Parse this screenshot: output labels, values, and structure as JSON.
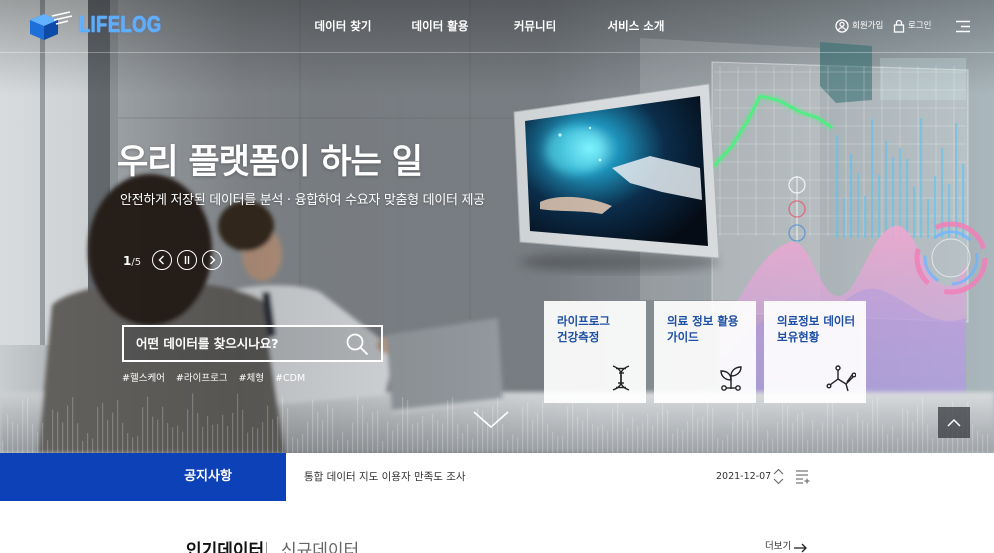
{
  "header": {
    "logo": {
      "text": "LIFELOG",
      "icon": "cube-logo-icon"
    },
    "nav": [
      {
        "label": "데이터 찾기"
      },
      {
        "label": "데이터 활용"
      },
      {
        "label": "커뮤니티"
      },
      {
        "label": "서비스 소개"
      }
    ],
    "utility": {
      "signup": {
        "label": "회원가입",
        "icon": "user-circle-icon"
      },
      "login": {
        "label": "로그인",
        "icon": "lock-icon"
      },
      "menu_icon": "hamburger-menu-icon"
    }
  },
  "hero": {
    "title": "우리 플랫폼이 하는 일",
    "subtitle": "안전하게 저장된 데이터를 분석 · 융합하여 수요자 맞춤형 데이터 제공",
    "slider": {
      "current": "1",
      "total_label": "/5",
      "prev_icon": "chevron-left-icon",
      "pause_icon": "pause-icon",
      "next_icon": "chevron-right-icon"
    },
    "search": {
      "placeholder": "어떤 데이터를 찾으시나요?",
      "icon": "search-icon",
      "tags": [
        "#헬스케어",
        "#라이프로그",
        "#체형",
        "#CDM"
      ]
    },
    "cards": [
      {
        "lines": [
          "라이프로그",
          "건강측정"
        ],
        "icon": "dna-icon"
      },
      {
        "lines": [
          "의료 정보 활용",
          "가이드"
        ],
        "icon": "sprout-icon"
      },
      {
        "lines": [
          "의료정보 데이터",
          "보유현황"
        ],
        "icon": "molecule-icon"
      }
    ],
    "scroll_down_icon": "chevron-down-icon",
    "scroll_top_icon": "chevron-up-icon"
  },
  "notice": {
    "label": "공지사항",
    "title": "통합 데이터 지도 이용자 만족도 조사",
    "date": "2021-12-07",
    "prev_icon": "chevron-up-small-icon",
    "next_icon": "chevron-down-small-icon",
    "list_icon": "list-add-icon"
  },
  "datasets": {
    "tabs": [
      {
        "label": "인기데이터",
        "active": true
      },
      {
        "label": "신규데이터",
        "active": false
      }
    ],
    "more_label": "더보기",
    "more_icon": "arrow-right-icon"
  },
  "colors": {
    "primary_blue": "#0d41b8",
    "card_text": "#1d4fa5",
    "logo_blue": "#5aaeff",
    "accent_green": "#4cf07f",
    "accent_pink": "#f3a6cf"
  }
}
